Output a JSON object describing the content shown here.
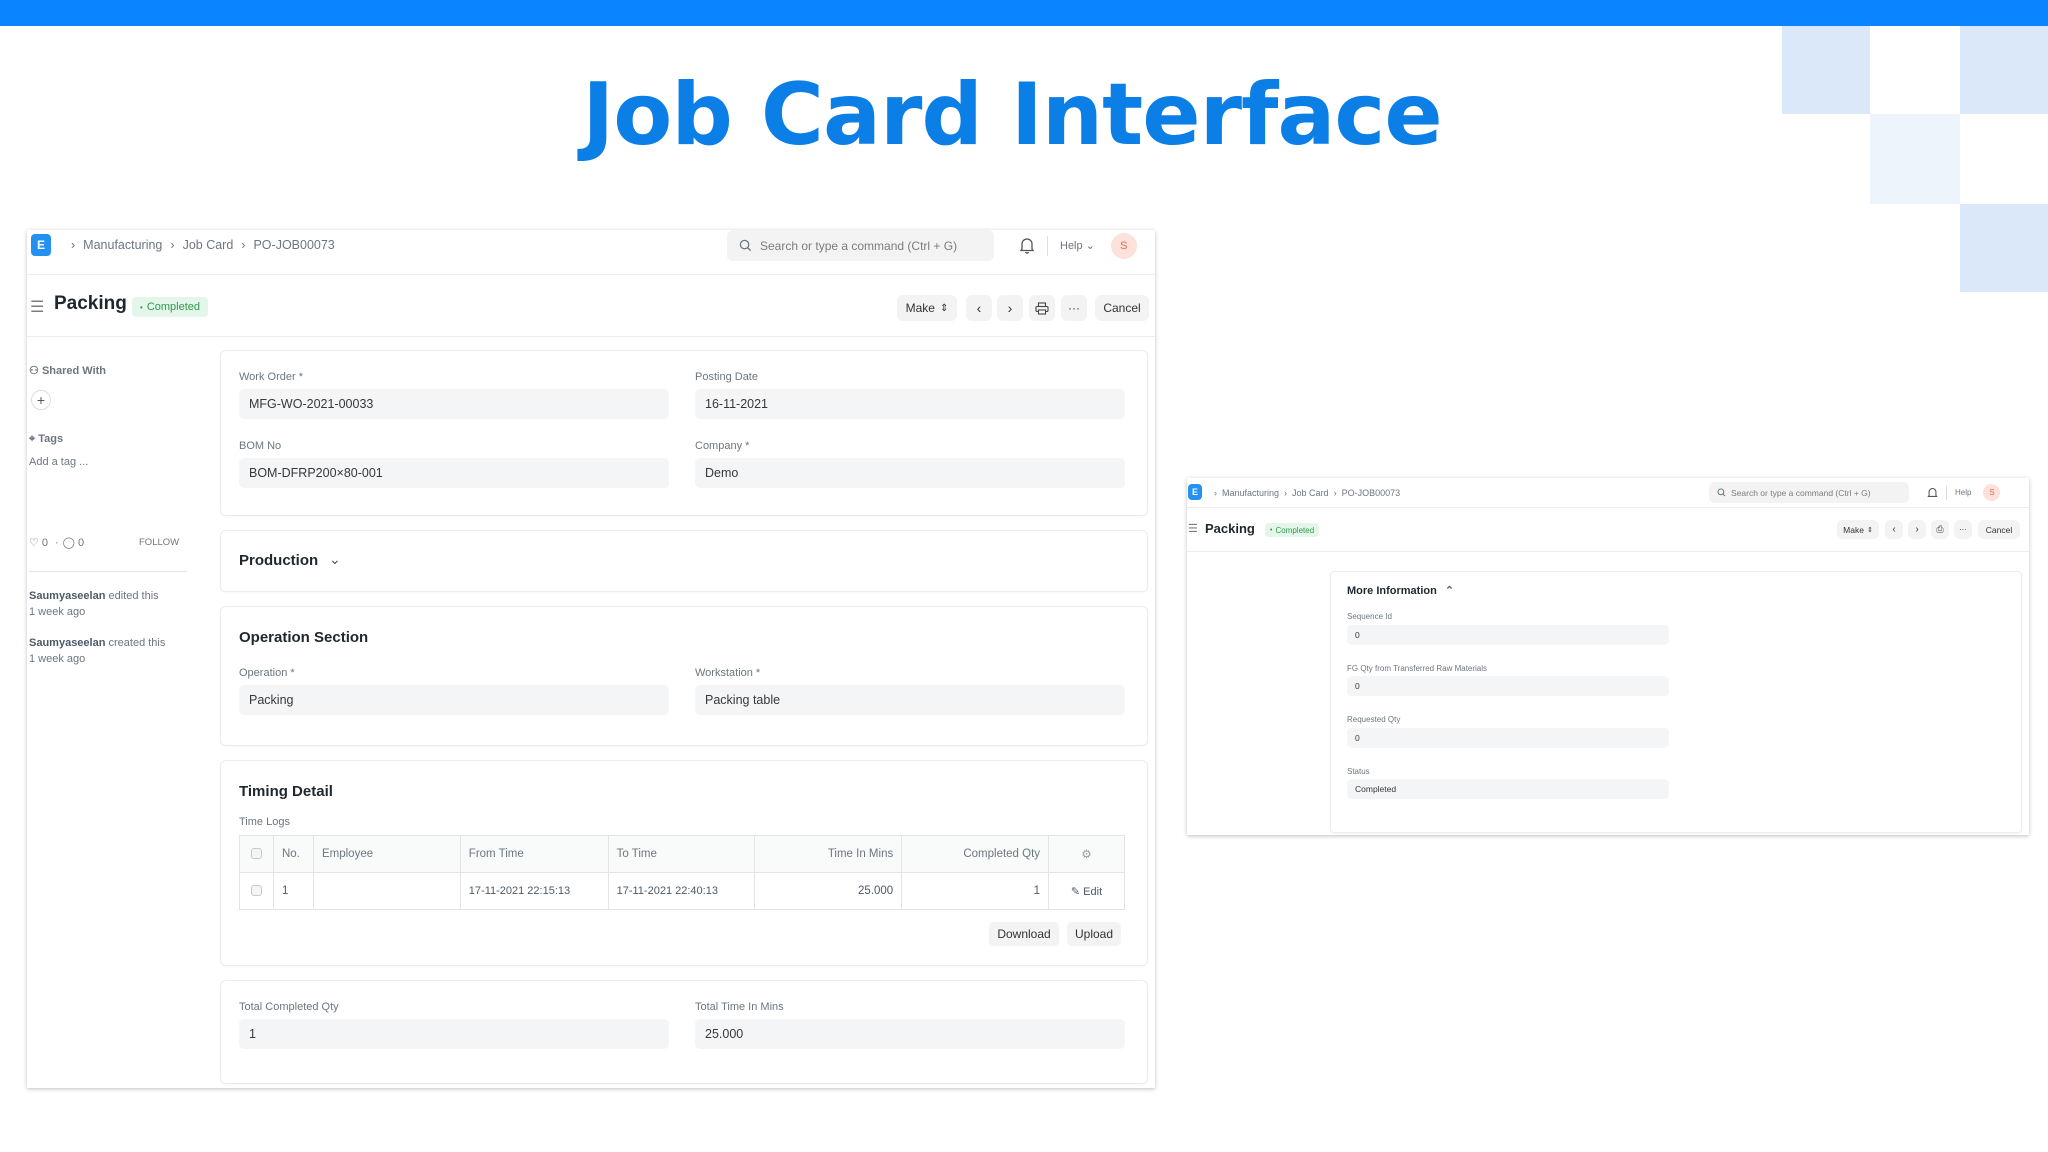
{
  "slide": {
    "title": "Job Card Interface"
  },
  "nav": {
    "logo": "E",
    "breadcrumbs": [
      "Manufacturing",
      "Job Card",
      "PO-JOB00073"
    ],
    "search_placeholder": "Search or type a command (Ctrl + G)",
    "help": "Help",
    "avatar": "S"
  },
  "page": {
    "title": "Packing",
    "status": "Completed",
    "make": "Make",
    "cancel": "Cancel",
    "more": "···"
  },
  "sidebar": {
    "shared_with": "Shared With",
    "tags": "Tags",
    "add_tag": "Add a tag ...",
    "likes": "0",
    "comments": "0",
    "follow": "FOLLOW",
    "activity": [
      {
        "user": "Saumyaseelan",
        "action": "edited this",
        "when": "1 week ago"
      },
      {
        "user": "Saumyaseelan",
        "action": "created this",
        "when": "1 week ago"
      }
    ]
  },
  "details": {
    "work_order_label": "Work Order *",
    "work_order": "MFG-WO-2021-00033",
    "posting_date_label": "Posting Date",
    "posting_date": "16-11-2021",
    "bom_label": "BOM No",
    "bom": "BOM-DFRP200×80-001",
    "company_label": "Company *",
    "company": "Demo"
  },
  "production": {
    "title": "Production"
  },
  "operation": {
    "title": "Operation Section",
    "operation_label": "Operation *",
    "operation": "Packing",
    "workstation_label": "Workstation *",
    "workstation": "Packing table"
  },
  "timing": {
    "title": "Timing Detail",
    "logs_label": "Time Logs",
    "columns": [
      "No.",
      "Employee",
      "From Time",
      "To Time",
      "Time In Mins",
      "Completed Qty"
    ],
    "rows": [
      {
        "no": "1",
        "employee": "",
        "from": "17-11-2021 22:15:13",
        "to": "17-11-2021 22:40:13",
        "mins": "25.000",
        "qty": "1",
        "edit": "Edit"
      }
    ],
    "download": "Download",
    "upload": "Upload"
  },
  "totals": {
    "qty_label": "Total Completed Qty",
    "qty": "1",
    "time_label": "Total Time In Mins",
    "time": "25.000"
  },
  "more_info": {
    "title": "More Information",
    "sequence_label": "Sequence Id",
    "sequence": "0",
    "fg_label": "FG Qty from Transferred Raw Materials",
    "fg": "0",
    "requested_label": "Requested Qty",
    "requested": "0",
    "status_label": "Status",
    "status": "Completed"
  },
  "colors": {
    "accent": "#0b7fe6",
    "topbar": "#0a84ff",
    "success": "#2f9a4b"
  }
}
